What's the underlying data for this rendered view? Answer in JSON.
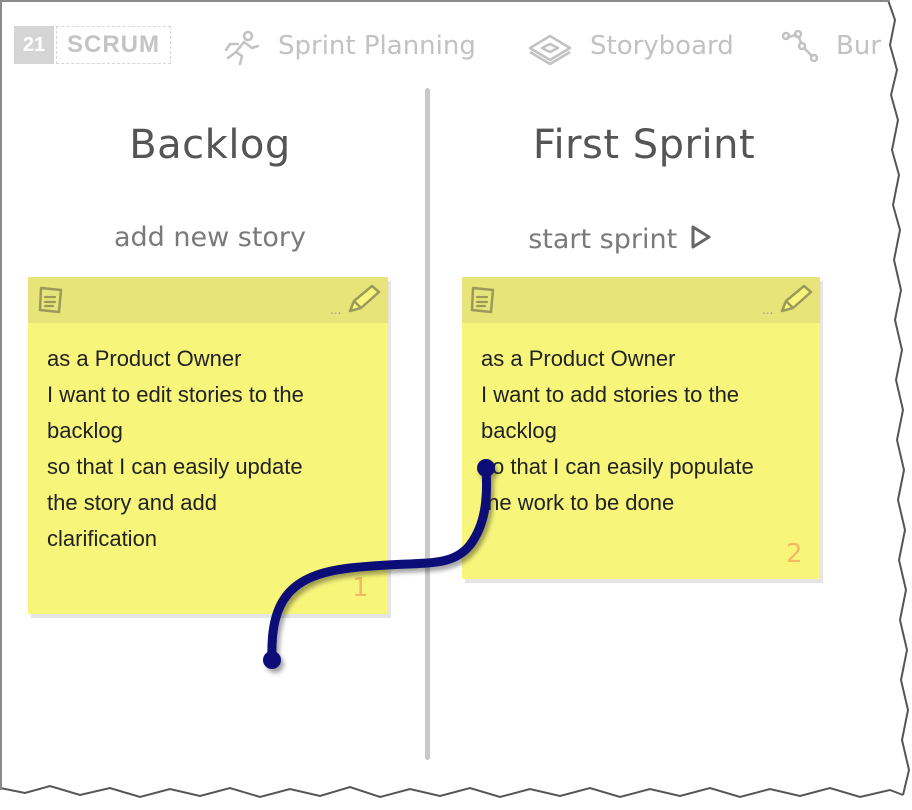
{
  "nav": {
    "brand_number": "21",
    "brand_name": "SCRUM",
    "items": [
      {
        "label": "Sprint Planning",
        "icon": "running-figure-icon"
      },
      {
        "label": "Storyboard",
        "icon": "storyboard-icon"
      },
      {
        "label": "Bur",
        "icon": "burndown-chart-icon"
      }
    ]
  },
  "columns": {
    "backlog": {
      "title": "Backlog",
      "action": "add new story",
      "card": {
        "lines": [
          "as a Product Owner",
          "I want to edit stories to the",
          "backlog",
          "so that I can easily update",
          "the story and add",
          "clarification"
        ],
        "number": "1"
      }
    },
    "sprint": {
      "title": "First Sprint",
      "action": "start sprint",
      "card": {
        "lines": [
          "as a Product Owner",
          "I want to add stories to the",
          "backlog",
          "so that I can easily populate",
          "the work to be done"
        ],
        "number": "2"
      }
    }
  },
  "colors": {
    "card": "#f7f57a",
    "card_header": "#e7e57a",
    "drag_path": "#0b0b78",
    "card_number": "#f4b860"
  },
  "icons": {
    "card": "note-icon",
    "edit": "pencil-icon",
    "play": "play-triangle-icon"
  }
}
